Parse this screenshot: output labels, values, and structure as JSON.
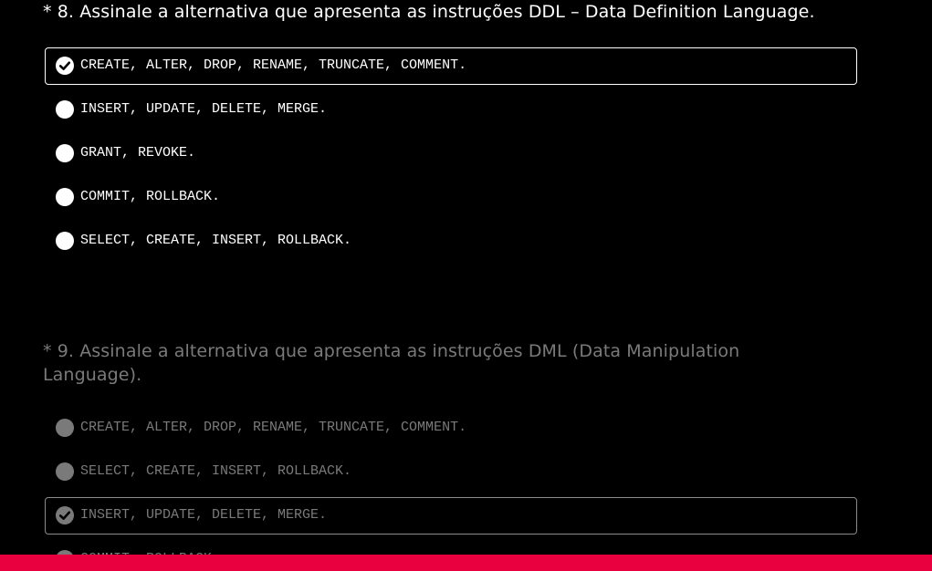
{
  "colors": {
    "background": "#000000",
    "active_text": "#ffffff",
    "inactive_text": "#7a7a7a",
    "bottom_bar": "#e8003f"
  },
  "questions": [
    {
      "title": "* 8. Assinale a alternativa que apresenta as instruções DDL – Data Definition Language.",
      "selected_index": 0,
      "options": [
        {
          "label": "CREATE, ALTER, DROP, RENAME, TRUNCATE, COMMENT."
        },
        {
          "label": "INSERT, UPDATE, DELETE, MERGE."
        },
        {
          "label": "GRANT, REVOKE."
        },
        {
          "label": "COMMIT, ROLLBACK."
        },
        {
          "label": "SELECT, CREATE, INSERT, ROLLBACK."
        }
      ]
    },
    {
      "title": "* 9. Assinale a alternativa que apresenta as instruções DML (Data Manipulation Language).",
      "selected_index": 2,
      "options": [
        {
          "label": "CREATE, ALTER, DROP, RENAME, TRUNCATE, COMMENT."
        },
        {
          "label": "SELECT, CREATE, INSERT, ROLLBACK."
        },
        {
          "label": "INSERT, UPDATE, DELETE, MERGE."
        },
        {
          "label": "COMMIT, ROLLBACK."
        }
      ]
    }
  ],
  "icons": {
    "selected": "check-circle-icon",
    "unselected": "radio-circle-icon"
  }
}
